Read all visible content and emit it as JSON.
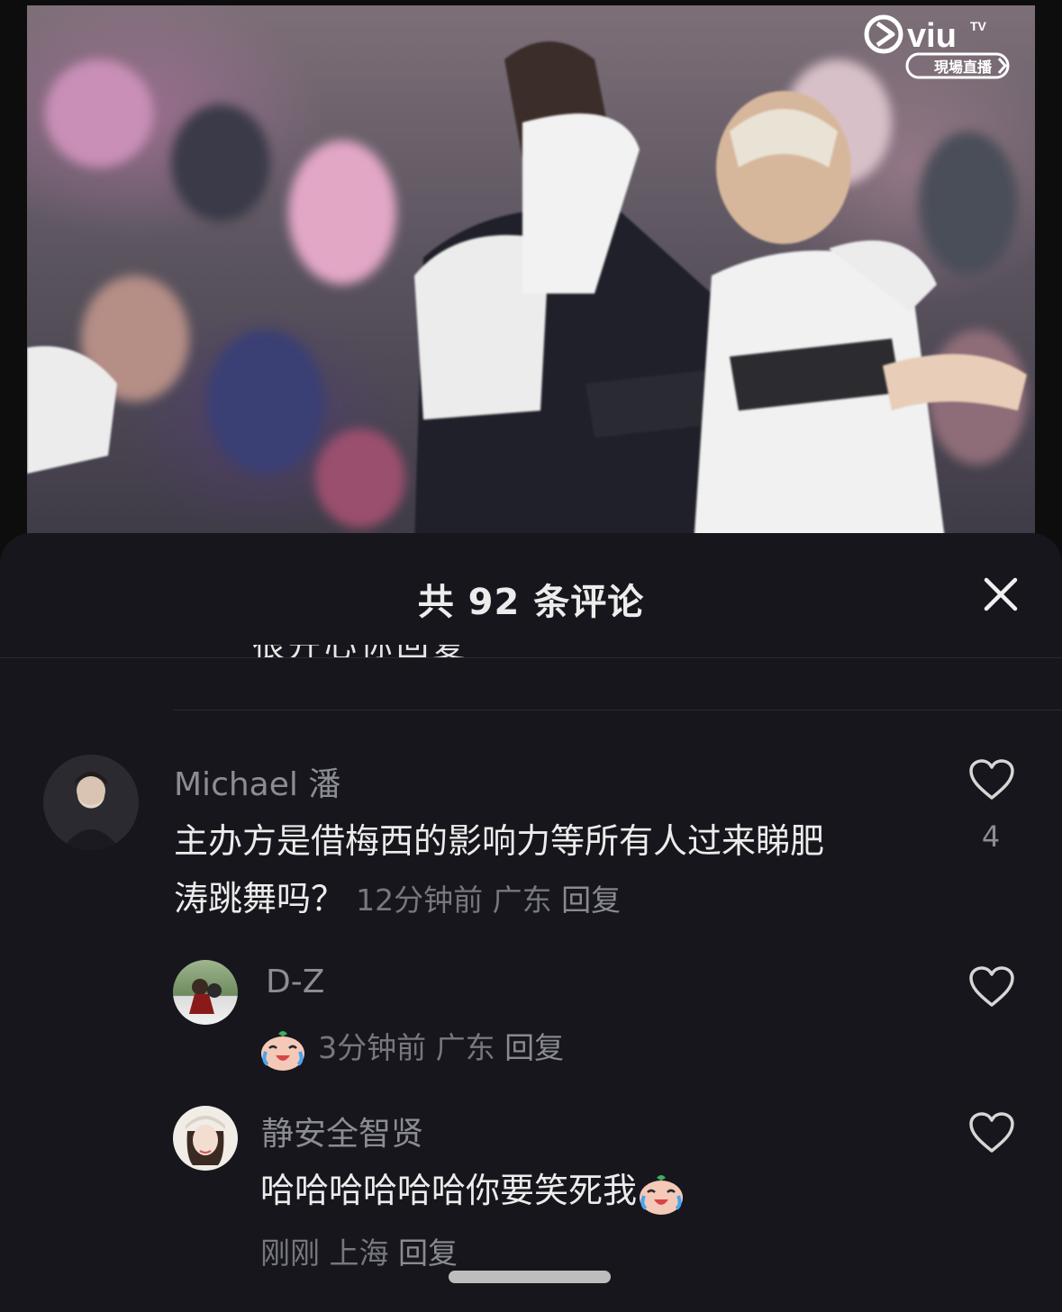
{
  "video": {
    "brand_logo_text": "viu",
    "brand_logo_sup": "TV",
    "live_badge": "現場直播"
  },
  "sheet": {
    "title": "共 92 条评论",
    "clipped_previous_text": "很开心你回复"
  },
  "comments": [
    {
      "username": "Michael 潘",
      "text_line1": "主办方是借梅西的影响力等所有人过来睇肥",
      "text_line2": "涛跳舞吗？",
      "time": "12分钟前",
      "location": "广东",
      "reply_label": "回复",
      "like_count": "4"
    },
    {
      "username": "D-Z",
      "emoji": "cry-laugh-emoji",
      "time": "3分钟前",
      "location": "广东",
      "reply_label": "回复"
    },
    {
      "username": "静安全智贤",
      "text": "哈哈哈哈哈哈你要笑死我",
      "emoji": "cry-laugh-emoji",
      "time": "刚刚",
      "location": "上海",
      "reply_label": "回复"
    }
  ],
  "colors": {
    "sheet_bg": "#16161c",
    "text_primary": "#ececec",
    "text_secondary": "#8c8c94"
  }
}
